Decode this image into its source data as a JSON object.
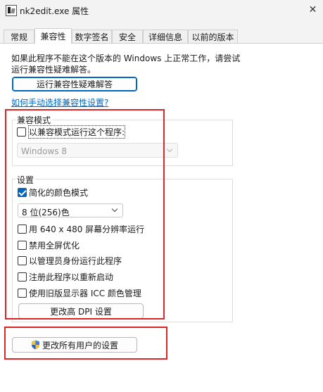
{
  "window": {
    "title": "nk2edit.exe 属性",
    "close_glyph": "✕"
  },
  "tabs": [
    {
      "label": "常规",
      "active": false
    },
    {
      "label": "兼容性",
      "active": true
    },
    {
      "label": "数字签名",
      "active": false
    },
    {
      "label": "安全",
      "active": false
    },
    {
      "label": "详细信息",
      "active": false
    },
    {
      "label": "以前的版本",
      "active": false
    }
  ],
  "compat": {
    "intro_line1": "如果此程序不能在这个版本的 Windows 上正常工作，请尝试",
    "intro_line2": "运行兼容性疑难解答。",
    "troubleshoot_button": "运行兼容性疑难解答",
    "manual_link": "如何手动选择兼容性设置?",
    "mode_group_label": "兼容模式",
    "mode_checkbox": {
      "label": "以兼容模式运行这个程序:",
      "checked": false
    },
    "mode_select": {
      "value": "Windows 8",
      "disabled": true
    },
    "settings_group_label": "设置",
    "reduced_color": {
      "label": "简化的颜色模式",
      "checked": true
    },
    "color_select": {
      "value": "8 位(256)色"
    },
    "options": [
      {
        "label": "用 640 x 480 屏幕分辨率运行",
        "checked": false
      },
      {
        "label": "禁用全屏优化",
        "checked": false
      },
      {
        "label": "以管理员身份运行此程序",
        "checked": false
      },
      {
        "label": "注册此程序以重新启动",
        "checked": false
      },
      {
        "label": "使用旧版显示器 ICC 颜色管理",
        "checked": false
      }
    ],
    "dpi_button": "更改高 DPI 设置",
    "all_users_button": "更改所有用户的设置",
    "icons": {
      "app": "app-icon",
      "shield": "uac-shield-icon",
      "chevron": "chevron-down-icon",
      "close": "close-icon"
    },
    "highlight_color": "#d92626",
    "accent_color": "#0067c0"
  }
}
